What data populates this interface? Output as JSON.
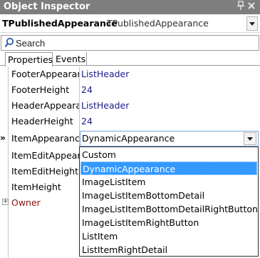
{
  "window": {
    "title": "Object Inspector",
    "pin_glyph": "📌",
    "close_glyph": "✕"
  },
  "selector": {
    "object_name": "TPublishedAppearance",
    "object_type": "TPublishedAppearance"
  },
  "search": {
    "placeholder": "Search",
    "icon": "search-icon"
  },
  "tabs": [
    {
      "label": "Properties",
      "active": true
    },
    {
      "label": "Events",
      "active": false
    }
  ],
  "properties": [
    {
      "name": "FooterAppearance",
      "value": "ListHeader"
    },
    {
      "name": "FooterHeight",
      "value": "24"
    },
    {
      "name": "HeaderAppearance",
      "value": "ListHeader"
    },
    {
      "name": "HeaderHeight",
      "value": "24"
    },
    {
      "name": "ItemAppearance",
      "value": "DynamicAppearance"
    },
    {
      "name": "ItemEditAppearance",
      "value": ""
    },
    {
      "name": "ItemEditHeight",
      "value": ""
    },
    {
      "name": "ItemHeight",
      "value": ""
    },
    {
      "name": "Owner",
      "value": ""
    }
  ],
  "markers": {
    "current_row": "»",
    "expand": "+"
  },
  "dropdown": {
    "options": [
      "Custom",
      "DynamicAppearance",
      "ImageListItem",
      "ImageListItemBottomDetail",
      "ImageListItemBottomDetailRightButton",
      "ImageListItemRightButton",
      "ListItem",
      "ListItemRightDetail"
    ],
    "selected_index": 1
  },
  "colors": {
    "title_bar": "#7e7e7e",
    "value_text": "#1a1a8c",
    "selection": "#3399ff",
    "owner_text": "#8b1010"
  }
}
